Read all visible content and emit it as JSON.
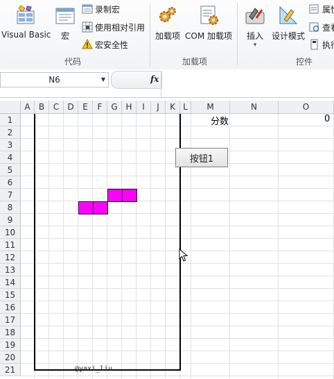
{
  "ribbon": {
    "visual_basic": "Visual Basic",
    "macro": "宏",
    "record_macro": "录制宏",
    "relative_ref": "使用相对引用",
    "macro_security": "宏安全性",
    "group_code": "代码",
    "addins": "加载项",
    "com_addins": "COM 加载项",
    "group_addins": "加载项",
    "insert": "插入",
    "design_mode": "设计模式",
    "properties": "属性",
    "view_code": "查看",
    "run_dialog": "执行",
    "group_controls": "控件"
  },
  "formula_bar": {
    "name_box": "N6",
    "fx": "fx",
    "formula": ""
  },
  "columns": [
    "A",
    "B",
    "C",
    "D",
    "E",
    "F",
    "G",
    "H",
    "I",
    "J",
    "K",
    "L",
    "M",
    "N",
    "O"
  ],
  "rows": [
    "1",
    "2",
    "3",
    "4",
    "5",
    "6",
    "7",
    "8",
    "9",
    "10",
    "11",
    "12",
    "13",
    "14",
    "15",
    "16",
    "17",
    "18",
    "19",
    "20",
    "21"
  ],
  "sheet": {
    "score_label": "分数",
    "score_value": "0",
    "button_label": "按钮1",
    "credit": "@yaxi_liu"
  },
  "piece": {
    "color": "#ff00ff",
    "cells": [
      [
        "G",
        7
      ],
      [
        "H",
        7
      ],
      [
        "E",
        8
      ],
      [
        "F",
        8
      ]
    ]
  },
  "board_range": {
    "from": "B1",
    "to": "K21"
  }
}
